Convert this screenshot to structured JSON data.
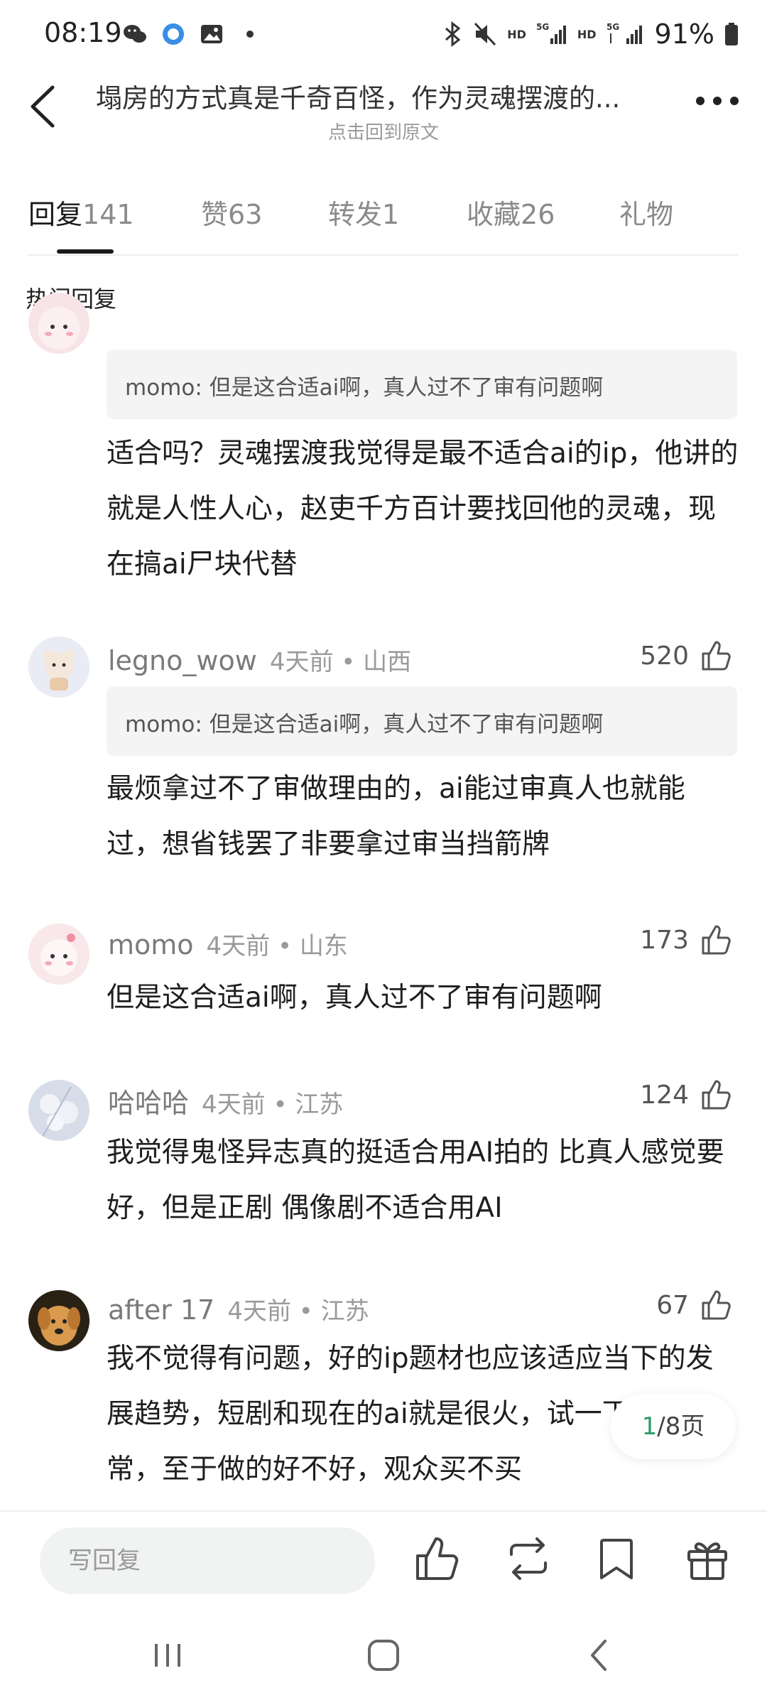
{
  "status_bar": {
    "time": "08:19",
    "battery": "91%",
    "hd1": "HD",
    "hd2": "HD",
    "fiveg1": "5G",
    "fiveg2": "5G"
  },
  "header": {
    "title": "塌房的方式真是千奇百怪，作为灵魂摆渡的...",
    "subtitle": "点击回到原文"
  },
  "tabs": [
    {
      "label": "回复",
      "count": "141"
    },
    {
      "label": "赞",
      "count": "63"
    },
    {
      "label": "转发",
      "count": "1"
    },
    {
      "label": "收藏",
      "count": "26"
    },
    {
      "label": "礼物",
      "count": ""
    }
  ],
  "section_label": "热门回复",
  "comments": [
    {
      "quote": "momo: 但是这合适ai啊，真人过不了审有问题啊",
      "body": "适合吗？灵魂摆渡我觉得是最不适合ai的ip，他讲的就是人性人心，赵吏千方百计要找回他的灵魂，现在搞ai尸块代替"
    },
    {
      "user": "legno_wow",
      "time": "4天前 • 山西",
      "likes": "520",
      "quote": "momo: 但是这合适ai啊，真人过不了审有问题啊",
      "body": "最烦拿过不了审做理由的，ai能过审真人也就能过，想省钱罢了非要拿过审当挡箭牌"
    },
    {
      "user": "momo",
      "time": "4天前 • 山东",
      "likes": "173",
      "body": "但是这合适ai啊，真人过不了审有问题啊"
    },
    {
      "user": "哈哈哈",
      "time": "4天前 • 江苏",
      "likes": "124",
      "body": "我觉得鬼怪异志真的挺适合用AI拍的  比真人感觉要好，但是正剧 偶像剧不适合用AI"
    },
    {
      "user": "after 17",
      "time": "4天前 • 江苏",
      "likes": "67",
      "body": "我不觉得有问题，好的ip题材也应该适应当下的发展趋势，短剧和现在的ai就是很火，试一下也正常，至于做的好不好，观众买不买"
    }
  ],
  "page_indicator": {
    "current": "1",
    "total": "/8页"
  },
  "bottom_bar": {
    "reply_placeholder": "写回复"
  },
  "icons": {
    "back": "chevron-left-icon",
    "more": "more-dots-icon",
    "like": "thumbs-up-icon",
    "repost": "repost-icon",
    "bookmark": "bookmark-icon",
    "gift": "gift-icon"
  },
  "colors": {
    "accent": "#2e9a6a",
    "quote_bg": "#f4f4f4",
    "input_bg": "#f0f3f1"
  }
}
